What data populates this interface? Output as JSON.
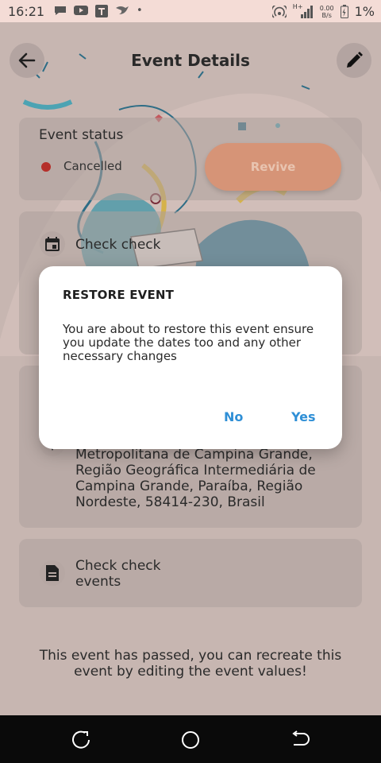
{
  "status_bar": {
    "time": "16:21",
    "network_type": "H+",
    "speed_value": "0.00",
    "speed_unit": "B/s",
    "battery": "1%"
  },
  "app_bar": {
    "title": "Event Details"
  },
  "event_status": {
    "heading": "Event status",
    "state": "Cancelled",
    "state_color": "#b52f2a",
    "revive_label": "Revive"
  },
  "schedule": {
    "title": "Check check"
  },
  "location": {
    "address": "Metropolitana de Campina Grande, Região Geográfica Intermediária de Campina Grande, Paraíba, Região Nordeste, 58414-230, Brasil"
  },
  "description": {
    "text": "Check check events"
  },
  "footer": {
    "message": "This event has passed, you can recreate this event by editing the event values!"
  },
  "dialog": {
    "title": "RESTORE EVENT",
    "message": "You are about to restore this event ensure you update the dates too and any other necessary changes",
    "no_label": "No",
    "yes_label": "Yes",
    "accent_color": "#2f8fd6"
  },
  "nav": {
    "icons": [
      "recent-apps-icon",
      "home-icon",
      "back-nav-icon"
    ]
  }
}
